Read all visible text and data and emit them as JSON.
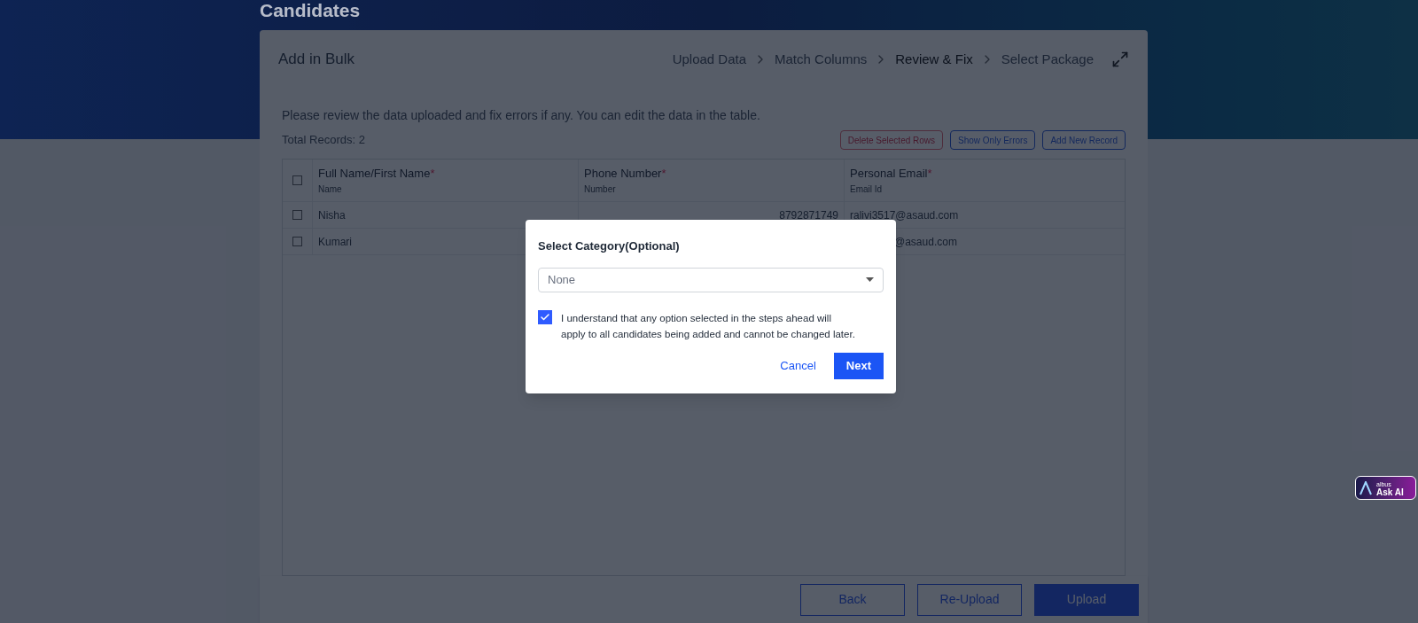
{
  "page": {
    "title": "Candidates"
  },
  "card": {
    "title": "Add in Bulk"
  },
  "steps": [
    {
      "label": "Upload Data",
      "selected": false
    },
    {
      "label": "Match Columns",
      "selected": false
    },
    {
      "label": "Review & Fix",
      "selected": true
    },
    {
      "label": "Select Package",
      "selected": false
    }
  ],
  "instructions": "Please review the data uploaded and fix errors if any. You can edit the data in the table.",
  "total_records": "Total Records: 2",
  "toolbar": [
    {
      "label": "Delete Selected Rows",
      "disabled": true
    },
    {
      "label": "Show Only Errors",
      "disabled": false
    },
    {
      "label": "Add New Record",
      "disabled": false
    }
  ],
  "table": {
    "header_checked": false,
    "columns": [
      {
        "label": "Full Name/First Name",
        "required_mark": "*",
        "subtitle": "Name"
      },
      {
        "label": "Phone Number",
        "required_mark": "*",
        "subtitle": "Number"
      },
      {
        "label": "Personal Email",
        "required_mark": "*",
        "subtitle": "Email Id"
      }
    ],
    "rows": [
      {
        "checked": false,
        "cells": [
          {
            "text": "Nisha",
            "kind": "text"
          },
          {
            "text": "8792871749",
            "kind": "number"
          },
          {
            "text": "ralivi3517@asaud.com",
            "kind": "text"
          }
        ]
      },
      {
        "checked": false,
        "cells": [
          {
            "text": "Kumari",
            "kind": "text"
          },
          {
            "text": "",
            "kind": "number"
          },
          {
            "text": "@asaud.com",
            "kind": "covered"
          }
        ]
      }
    ]
  },
  "footer_buttons": [
    {
      "label": "Back",
      "kind": "outline"
    },
    {
      "label": "Re-Upload",
      "kind": "outline"
    },
    {
      "label": "Upload",
      "kind": "primary"
    }
  ],
  "dialog": {
    "title": "Select Category(Optional)",
    "select": {
      "value": "None"
    },
    "consent": {
      "checked": true,
      "text": "I understand that any option selected in the steps ahead will apply to all candidates being added and cannot be changed later."
    },
    "buttons": [
      {
        "label": "Cancel",
        "kind": "link"
      },
      {
        "label": "Next",
        "kind": "primary"
      }
    ]
  },
  "assistant": {
    "brand": "albus",
    "label": "Ask AI"
  }
}
